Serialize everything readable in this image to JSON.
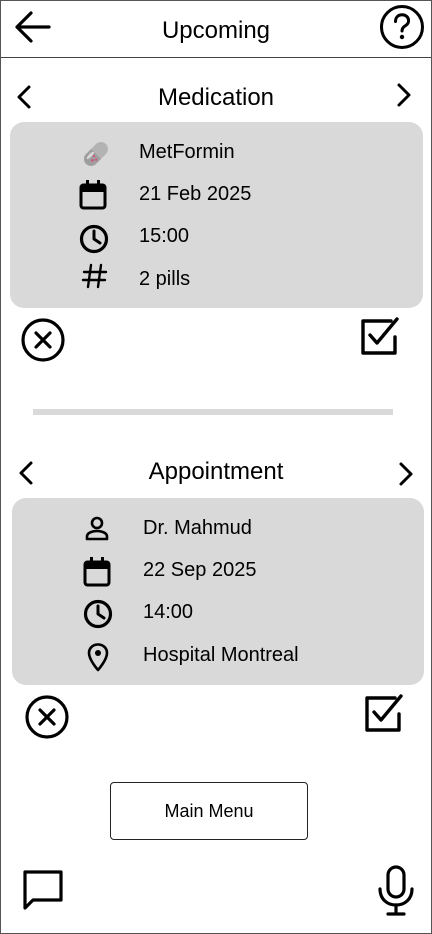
{
  "header": {
    "title": "Upcoming",
    "back_icon": "arrow-left-icon",
    "help_icon": "help-icon"
  },
  "medication": {
    "title": "Medication",
    "name": "MetFormin",
    "date": "21 Feb 2025",
    "time": "15:00",
    "quantity": "2 pills",
    "icons": [
      "pill-icon",
      "calendar-icon",
      "clock-icon",
      "hash-icon"
    ]
  },
  "appointment": {
    "title": "Appointment",
    "doctor": "Dr. Mahmud",
    "date": "22 Sep 2025",
    "time": "14:00",
    "location": "Hospital Montreal",
    "icons": [
      "person-icon",
      "calendar-icon",
      "clock-icon",
      "location-pin-icon"
    ]
  },
  "footer": {
    "main_menu_label": "Main Menu",
    "chat_icon": "chat-icon",
    "mic_icon": "microphone-icon"
  },
  "colors": {
    "card_background": "#d9d9d9",
    "divider": "#d9d9d9",
    "pill_body": "#b3b3b3",
    "pill_dots": "#d94a7a"
  }
}
